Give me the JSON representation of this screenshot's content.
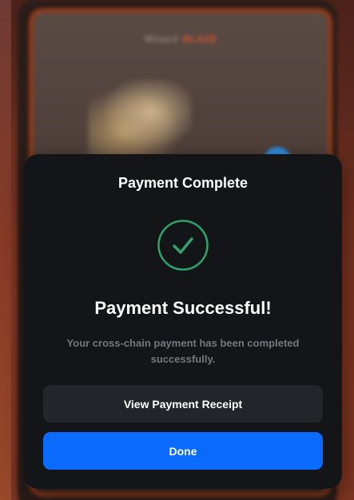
{
  "backdrop": {
    "title": "Wizard",
    "accent": "BLAZE"
  },
  "modal": {
    "title": "Payment Complete",
    "status_icon": "check-circle-icon",
    "headline": "Payment Successful!",
    "message": "Your cross-chain payment has been completed successfully.",
    "receipt_button_label": "View Payment Receipt",
    "done_button_label": "Done"
  },
  "colors": {
    "modal_background": "#141518",
    "success_green": "#2fa36b",
    "primary_blue": "#0b6bff",
    "secondary_button": "#24252b",
    "muted_text": "#74777e"
  }
}
